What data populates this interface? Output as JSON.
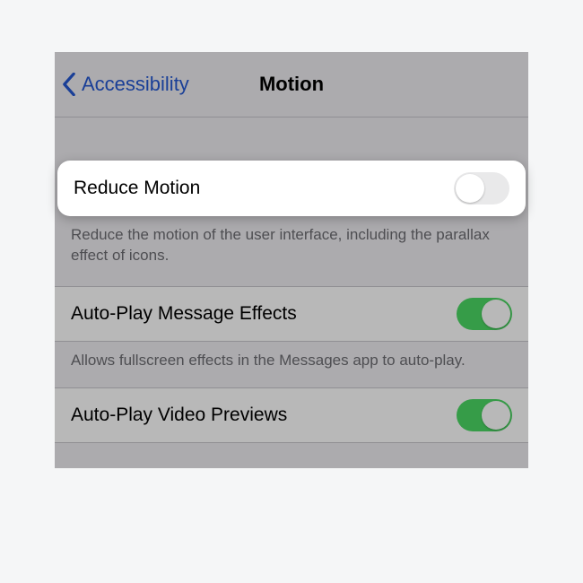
{
  "nav": {
    "back_label": "Accessibility",
    "title": "Motion"
  },
  "rows": {
    "reduce_motion": {
      "label": "Reduce Motion",
      "on": false
    },
    "auto_play_message_effects": {
      "label": "Auto-Play Message Effects",
      "on": true
    },
    "auto_play_video_previews": {
      "label": "Auto-Play Video Previews",
      "on": true
    }
  },
  "footers": {
    "reduce_motion": "Reduce the motion of the user interface, including the parallax effect of icons.",
    "auto_play_message_effects": "Allows fullscreen effects in the Messages app to auto-play."
  },
  "colors": {
    "link": "#2458d2",
    "switch_on": "#4cd964",
    "switch_off": "#e9e9ea"
  }
}
